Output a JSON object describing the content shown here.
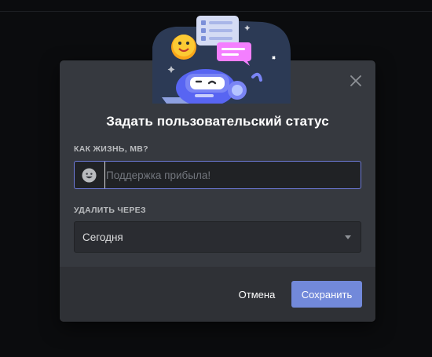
{
  "modal": {
    "title": "Задать пользовательский статус",
    "status_label": "КАК ЖИЗНЬ, МВ?",
    "status_input": {
      "value": "",
      "placeholder": "Поддержка прибыла!"
    },
    "clear_label": "УДАЛИТЬ ЧЕРЕЗ",
    "clear_after": {
      "selected": "Сегодня"
    },
    "buttons": {
      "cancel": "Отмена",
      "save": "Сохранить"
    }
  },
  "icons": {
    "close": "close-icon",
    "emoji": "smiley-emoji-icon",
    "dropdown": "chevron-down-icon",
    "illustration": "wumpus-status-illustration"
  },
  "colors": {
    "background": "#0b0c0e",
    "modal": "#36393f",
    "footer": "#2f3136",
    "input": "#202225",
    "focus_border": "#6e7bd9",
    "accent": "#7289da",
    "title_text": "#ffffff",
    "label_text": "#b9bbbe",
    "placeholder_text": "#72767d"
  }
}
